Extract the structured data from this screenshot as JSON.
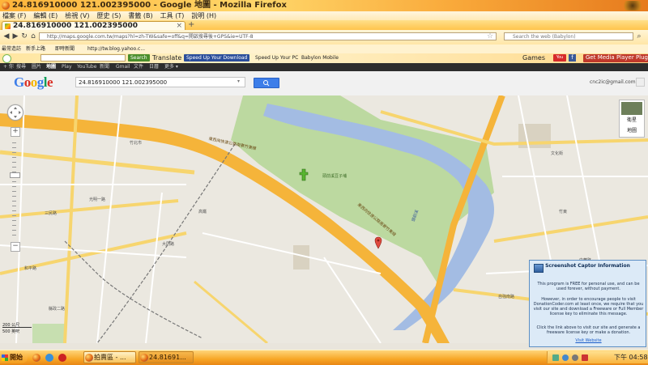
{
  "window": {
    "title": "24.816910000 121.002395000 - Google 地圖 - Mozilla Firefox"
  },
  "menu": [
    "檔案 (F)",
    "編輯 (E)",
    "檢視 (V)",
    "歷史 (S)",
    "書籤 (B)",
    "工具 (T)",
    "說明 (H)"
  ],
  "tab": {
    "label": "24.816910000 121.002395000",
    "close": "×"
  },
  "nav": {
    "url": "http://maps.google.com.tw/maps?hl=zh-TW&safe=off&q=開啟搜尋後+GPS&ie=UTF-8",
    "search_placeholder": "Search the web (Babylon)"
  },
  "bookmarks": [
    "最常造訪",
    "新手上路",
    "即時新聞",
    "http://tw.blog.yahoo.c..."
  ],
  "sunbar": {
    "search_btn": "Search",
    "translate": "Translate",
    "download_btn": "Speed Up Your Download",
    "speedpc": "Speed Up Your PC",
    "babylon": "Babylon Mobile",
    "games": "Games",
    "media_btn": "Get Media Player Plugin"
  },
  "gbar": [
    "+ 你",
    "搜尋",
    "圖片",
    "地圖",
    "Play",
    "YouTube",
    "新聞",
    "Gmail",
    "文件",
    "日曆",
    "更多 ▾"
  ],
  "gbar_user": "cnc2ic@gmail.com ▾",
  "gsearch": {
    "logo": "Google",
    "query": "24.816910000 121.002395000"
  },
  "map": {
    "labels": [
      "東西向快速公路南寮竹東線",
      "東西向快速公路南寮竹東線",
      "頭前溪豆子埔",
      "頭前溪",
      "竹北市",
      "竹東",
      "三民路",
      "光明一路",
      "大同路",
      "和平路",
      "中華路",
      "文化街",
      "高鐵",
      "自強南路",
      "縣政二路"
    ],
    "zoom_plus": "+",
    "zoom_minus": "−",
    "view_map": "地圖",
    "view_sat": "衛星",
    "scale_1": "200 公尺",
    "scale_2": "500 英呎"
  },
  "popup": {
    "title": "Screenshot Captor Information",
    "p1": "This program is FREE for personal use, and can be used forever, without payment.",
    "p2": "However, in order to encourage people to visit DonationCoder.com at least once, we require that you visit our site and download a Freeware or Full Member license key to eliminate this message.",
    "p3": "Click the link above to visit our site and generate a freeware license key or make a donation.",
    "link": "Visit Website"
  },
  "taskbar": {
    "start": "開始",
    "btn1": "拍賣區 - ...",
    "btn2": "24.81691...",
    "clock": "下午 04:58"
  }
}
